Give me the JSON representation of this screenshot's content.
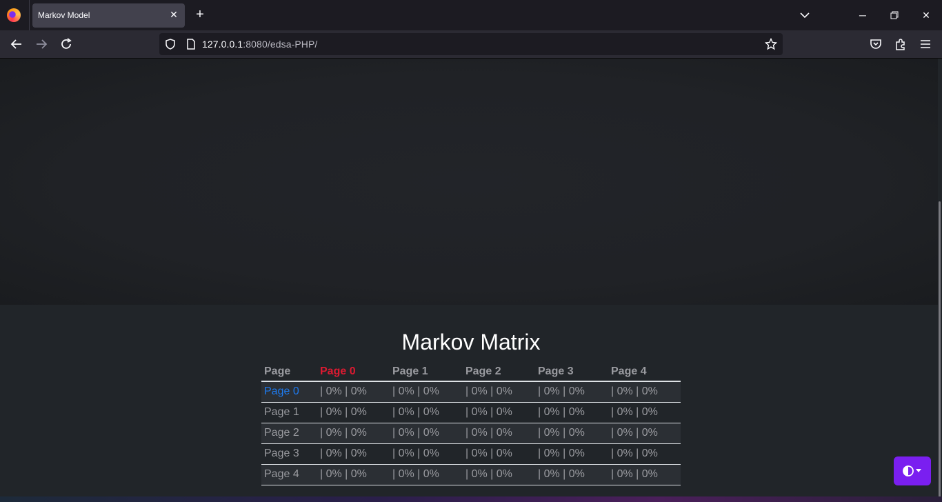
{
  "browser": {
    "tab_title": "Markov Model",
    "url_host": "127.0.0.1",
    "url_rest": ":8080/edsa-PHP/"
  },
  "page": {
    "title": "Markov Matrix"
  },
  "matrix": {
    "headers": [
      "Page",
      "Page 0",
      "Page 1",
      "Page 2",
      "Page 3",
      "Page 4"
    ],
    "rows": [
      {
        "label": "Page 0",
        "cells": [
          "| 0% | 0%",
          "| 0% | 0%",
          "| 0% | 0%",
          "| 0% | 0%",
          "| 0% | 0%"
        ]
      },
      {
        "label": "Page 1",
        "cells": [
          "| 0% | 0%",
          "| 0% | 0%",
          "| 0% | 0%",
          "| 0% | 0%",
          "| 0% | 0%"
        ]
      },
      {
        "label": "Page 2",
        "cells": [
          "| 0% | 0%",
          "| 0% | 0%",
          "| 0% | 0%",
          "| 0% | 0%",
          "| 0% | 0%"
        ]
      },
      {
        "label": "Page 3",
        "cells": [
          "| 0% | 0%",
          "| 0% | 0%",
          "| 0% | 0%",
          "| 0% | 0%",
          "| 0% | 0%"
        ]
      },
      {
        "label": "Page 4",
        "cells": [
          "| 0% | 0%",
          "| 0% | 0%",
          "| 0% | 0%",
          "| 0% | 0%",
          "| 0% | 0%"
        ]
      }
    ]
  },
  "colors": {
    "active_column": "#dc1a31",
    "active_row": "#1e7bf0",
    "theme_button": "#7a1ff0"
  }
}
